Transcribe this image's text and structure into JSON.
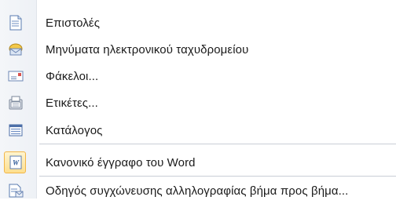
{
  "menu": {
    "items": [
      {
        "label": "Επιστολές",
        "icon": "letter-document-icon",
        "checked": false
      },
      {
        "label": "Μηνύματα ηλεκτρονικού ταχυδρομείου",
        "icon": "email-message-icon",
        "checked": false
      },
      {
        "label": "Φάκελοι...",
        "icon": "envelope-icon",
        "checked": false
      },
      {
        "label": "Ετικέτες...",
        "icon": "labels-icon",
        "checked": false
      },
      {
        "label": "Κατάλογος",
        "icon": "directory-list-icon",
        "checked": false
      },
      {
        "label": "Κανονικό έγγραφο του Word",
        "icon": "word-document-icon",
        "checked": true
      },
      {
        "label": "Οδηγός συγχώνευσης αλληλογραφίας βήμα προς βήμα...",
        "icon": "mail-merge-wizard-icon",
        "checked": false
      }
    ]
  }
}
